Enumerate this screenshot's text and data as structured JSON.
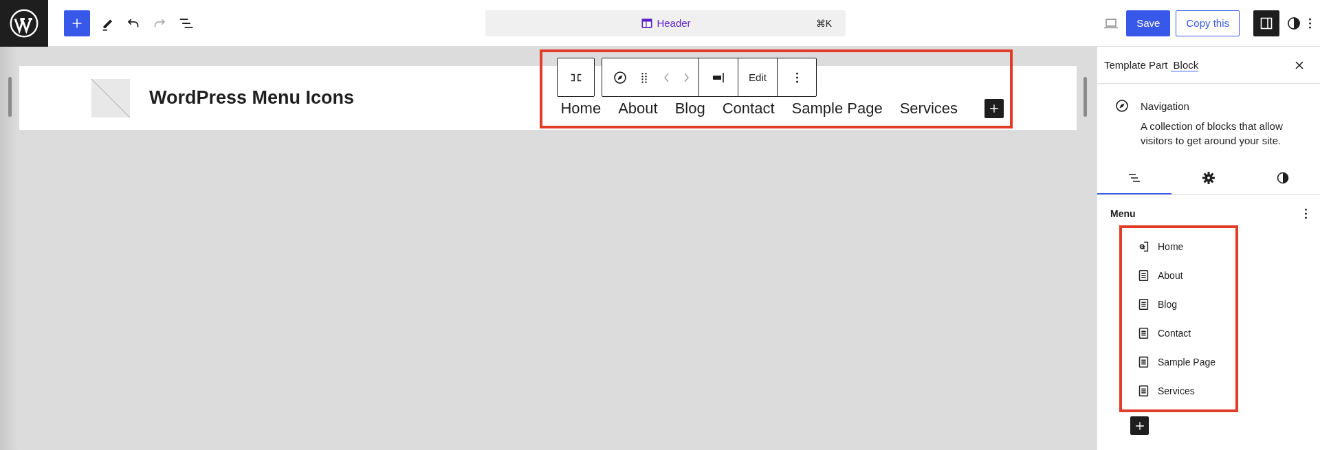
{
  "top_bar": {
    "undo": {
      "disabled": false
    },
    "redo": {
      "disabled": true
    },
    "command_bar": {
      "title": "Header",
      "shortcut": "⌘K"
    },
    "buttons": [
      {
        "label": "Save",
        "kind": "primary"
      },
      {
        "label": "Copy this",
        "kind": "secondary"
      }
    ],
    "sidebar_toggle": {
      "pressed": true
    }
  },
  "canvas": {
    "site_title": "WordPress Menu Icons",
    "navigation": {
      "highlighted": true,
      "items": [
        {
          "label": "Home"
        },
        {
          "label": "About"
        },
        {
          "label": "Blog"
        },
        {
          "label": "Contact"
        },
        {
          "label": "Sample Page"
        },
        {
          "label": "Services"
        }
      ]
    },
    "block_toolbar": {
      "edit_label": "Edit"
    }
  },
  "sidebar": {
    "title": "Template Part",
    "title_link": "Block",
    "block": {
      "name": "Navigation",
      "description": "A collection of blocks that allow visitors to get around your site."
    },
    "tabs": [
      {
        "kind": "list",
        "selected": true
      },
      {
        "kind": "settings",
        "selected": false
      },
      {
        "kind": "styles",
        "selected": false
      }
    ],
    "menu": {
      "title": "Menu",
      "highlighted": true,
      "items": [
        {
          "label": "Home",
          "kind": "link"
        },
        {
          "label": "About",
          "kind": "page"
        },
        {
          "label": "Blog",
          "kind": "page"
        },
        {
          "label": "Contact",
          "kind": "page"
        },
        {
          "label": "Sample Page",
          "kind": "page"
        },
        {
          "label": "Services",
          "kind": "page"
        }
      ]
    }
  }
}
